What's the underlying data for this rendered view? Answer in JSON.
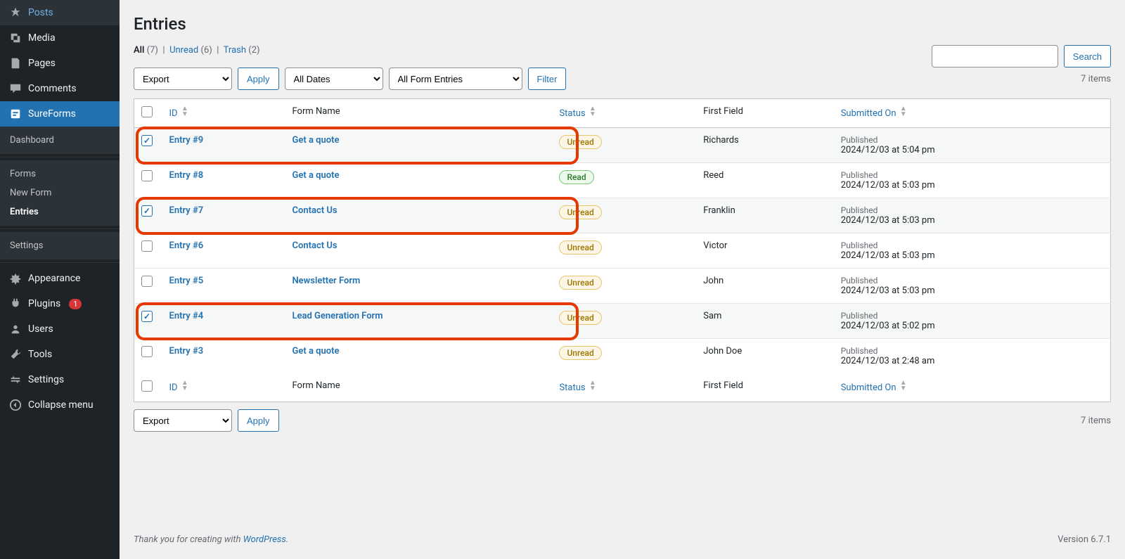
{
  "sidebar": {
    "items": [
      {
        "label": "Posts",
        "icon": "pin"
      },
      {
        "label": "Media",
        "icon": "media"
      },
      {
        "label": "Pages",
        "icon": "page"
      },
      {
        "label": "Comments",
        "icon": "comment"
      },
      {
        "label": "SureForms",
        "icon": "form"
      }
    ],
    "sub": [
      {
        "label": "Dashboard"
      },
      {
        "label": "Forms"
      },
      {
        "label": "New Form"
      },
      {
        "label": "Entries"
      },
      {
        "label": "Settings"
      }
    ],
    "items2": [
      {
        "label": "Appearance",
        "icon": "appearance"
      },
      {
        "label": "Plugins",
        "icon": "plugin",
        "badge": "1"
      },
      {
        "label": "Users",
        "icon": "users"
      },
      {
        "label": "Tools",
        "icon": "tools"
      },
      {
        "label": "Settings",
        "icon": "settings"
      },
      {
        "label": "Collapse menu",
        "icon": "collapse"
      }
    ]
  },
  "page": {
    "title": "Entries",
    "views": {
      "all_label": "All",
      "all_count": "(7)",
      "unread_label": "Unread",
      "unread_count": "(6)",
      "trash_label": "Trash",
      "trash_count": "(2)",
      "sep": "|"
    },
    "search_label": "Search",
    "bulk_action": "Export",
    "apply_label": "Apply",
    "date_filter": "All Dates",
    "form_filter": "All Form Entries",
    "filter_label": "Filter",
    "items_count": "7 items"
  },
  "columns": {
    "id": "ID",
    "form": "Form Name",
    "status": "Status",
    "first": "First Field",
    "submitted": "Submitted On"
  },
  "rows": [
    {
      "checked": true,
      "id": "Entry #9",
      "form": "Get a quote",
      "status": "Unread",
      "first": "Richards",
      "pub": "Published",
      "date": "2024/12/03 at 5:04 pm",
      "hl": true
    },
    {
      "checked": false,
      "id": "Entry #8",
      "form": "Get a quote",
      "status": "Read",
      "first": "Reed",
      "pub": "Published",
      "date": "2024/12/03 at 5:03 pm",
      "hl": false
    },
    {
      "checked": true,
      "id": "Entry #7",
      "form": "Contact Us",
      "status": "Unread",
      "first": "Franklin",
      "pub": "Published",
      "date": "2024/12/03 at 5:03 pm",
      "hl": true
    },
    {
      "checked": false,
      "id": "Entry #6",
      "form": "Contact Us",
      "status": "Unread",
      "first": "Victor",
      "pub": "Published",
      "date": "2024/12/03 at 5:03 pm",
      "hl": false
    },
    {
      "checked": false,
      "id": "Entry #5",
      "form": "Newsletter Form",
      "status": "Unread",
      "first": "John",
      "pub": "Published",
      "date": "2024/12/03 at 5:03 pm",
      "hl": false
    },
    {
      "checked": true,
      "id": "Entry #4",
      "form": "Lead Generation Form",
      "status": "Unread",
      "first": "Sam",
      "pub": "Published",
      "date": "2024/12/03 at 5:02 pm",
      "hl": true
    },
    {
      "checked": false,
      "id": "Entry #3",
      "form": "Get a quote",
      "status": "Unread",
      "first": "John Doe",
      "pub": "Published",
      "date": "2024/12/03 at 2:48 am",
      "hl": false
    }
  ],
  "footer": {
    "thanks_prefix": "Thank you for creating with ",
    "wp": "WordPress",
    "thanks_suffix": ".",
    "version": "Version 6.7.1"
  }
}
